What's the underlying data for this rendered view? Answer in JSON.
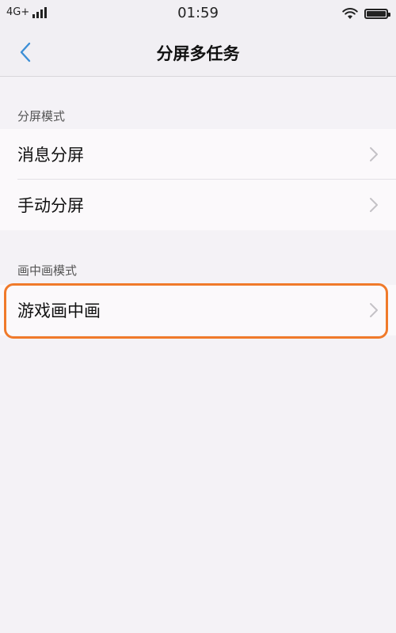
{
  "status_bar": {
    "network": "4G+",
    "time": "01:59",
    "icons": [
      "signal-icon",
      "wifi-icon",
      "battery-icon"
    ],
    "battery_level": 1.0
  },
  "header": {
    "title": "分屏多任务",
    "back_icon": "chevron-left-icon",
    "accent_color": "#3d8fd6"
  },
  "sections": [
    {
      "title": "分屏模式",
      "items": [
        {
          "label": "消息分屏",
          "icon": "chevron-right-icon"
        },
        {
          "label": "手动分屏",
          "icon": "chevron-right-icon"
        }
      ]
    },
    {
      "title": "画中画模式",
      "items": [
        {
          "label": "游戏画中画",
          "icon": "chevron-right-icon"
        }
      ]
    }
  ],
  "highlight_color": "#f07a2a"
}
